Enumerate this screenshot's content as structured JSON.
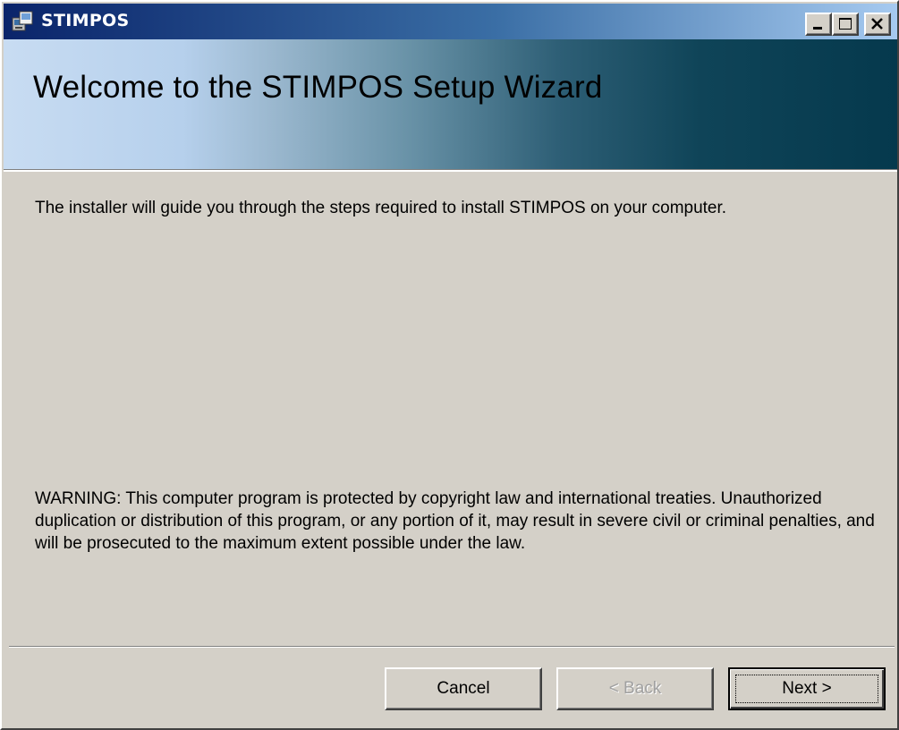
{
  "window": {
    "title": "STIMPOS",
    "icon": "installer-icon",
    "controls": [
      "minimize-icon",
      "maximize-icon",
      "close-icon"
    ]
  },
  "banner": {
    "title": "Welcome to the STIMPOS Setup Wizard"
  },
  "body": {
    "intro": "The installer will guide you through the steps required to install STIMPOS on your computer.",
    "warning": "WARNING: This computer program is protected by copyright law and international treaties. Unauthorized duplication or distribution of this program, or any portion of it, may result in severe civil or criminal penalties, and will be prosecuted to the maximum extent possible under the law."
  },
  "buttons": {
    "cancel_label": "Cancel",
    "back_label": "< Back",
    "back_enabled": false,
    "next_label": "Next >",
    "next_default": true
  },
  "colors": {
    "titlebar_start": "#0a246a",
    "titlebar_end": "#a6caf0",
    "banner_dark": "#05394d",
    "face": "#d4d0c8"
  }
}
